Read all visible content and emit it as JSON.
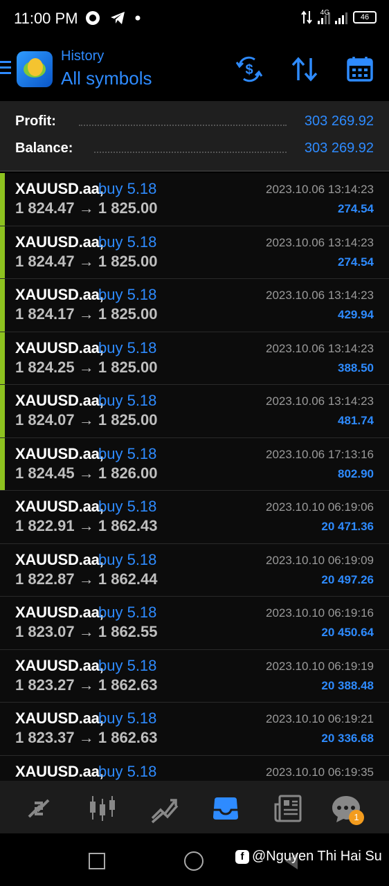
{
  "status_bar": {
    "time": "11:00 PM",
    "network_label": "4G",
    "battery": "46"
  },
  "header": {
    "subtitle": "History",
    "title": "All symbols",
    "icons": [
      "menu-icon",
      "currency-exchange-icon",
      "sort-icon",
      "calendar-icon"
    ]
  },
  "summary": {
    "profit_label": "Profit:",
    "profit_value": "303 269.92",
    "balance_label": "Balance:",
    "balance_value": "303 269.92"
  },
  "colors": {
    "accent": "#2e8bff",
    "marker": "#8dc21f",
    "badge": "#f39c1e"
  },
  "trades": [
    {
      "symbol": "XAUUSD.aa,",
      "type": "buy 5.18",
      "prices": "1 824.47 → 1 825.00",
      "date": "2023.10.06 13:14:23",
      "profit": "274.54",
      "marked": true
    },
    {
      "symbol": "XAUUSD.aa,",
      "type": "buy 5.18",
      "prices": "1 824.47 → 1 825.00",
      "date": "2023.10.06 13:14:23",
      "profit": "274.54",
      "marked": true
    },
    {
      "symbol": "XAUUSD.aa,",
      "type": "buy 5.18",
      "prices": "1 824.17 → 1 825.00",
      "date": "2023.10.06 13:14:23",
      "profit": "429.94",
      "marked": true
    },
    {
      "symbol": "XAUUSD.aa,",
      "type": "buy 5.18",
      "prices": "1 824.25 → 1 825.00",
      "date": "2023.10.06 13:14:23",
      "profit": "388.50",
      "marked": true
    },
    {
      "symbol": "XAUUSD.aa,",
      "type": "buy 5.18",
      "prices": "1 824.07 → 1 825.00",
      "date": "2023.10.06 13:14:23",
      "profit": "481.74",
      "marked": true
    },
    {
      "symbol": "XAUUSD.aa,",
      "type": "buy 5.18",
      "prices": "1 824.45 → 1 826.00",
      "date": "2023.10.06 17:13:16",
      "profit": "802.90",
      "marked": true
    },
    {
      "symbol": "XAUUSD.aa,",
      "type": "buy 5.18",
      "prices": "1 822.91 → 1 862.43",
      "date": "2023.10.10 06:19:06",
      "profit": "20 471.36",
      "marked": false
    },
    {
      "symbol": "XAUUSD.aa,",
      "type": "buy 5.18",
      "prices": "1 822.87 → 1 862.44",
      "date": "2023.10.10 06:19:09",
      "profit": "20 497.26",
      "marked": false
    },
    {
      "symbol": "XAUUSD.aa,",
      "type": "buy 5.18",
      "prices": "1 823.07 → 1 862.55",
      "date": "2023.10.10 06:19:16",
      "profit": "20 450.64",
      "marked": false
    },
    {
      "symbol": "XAUUSD.aa,",
      "type": "buy 5.18",
      "prices": "1 823.27 → 1 862.63",
      "date": "2023.10.10 06:19:19",
      "profit": "20 388.48",
      "marked": false
    },
    {
      "symbol": "XAUUSD.aa,",
      "type": "buy 5.18",
      "prices": "1 823.37 → 1 862.63",
      "date": "2023.10.10 06:19:21",
      "profit": "20 336.68",
      "marked": false
    },
    {
      "symbol": "XAUUSD.aa,",
      "type": "buy 5.18",
      "prices": "",
      "date": "2023.10.10 06:19:35",
      "profit": "",
      "marked": false
    }
  ],
  "bottom_nav": {
    "items": [
      "quotes-icon",
      "chart-icon",
      "trade-icon",
      "history-icon",
      "news-icon",
      "chat-icon"
    ],
    "chat_badge": "1"
  },
  "watermark": "@Nguyen Thi Hai Su"
}
